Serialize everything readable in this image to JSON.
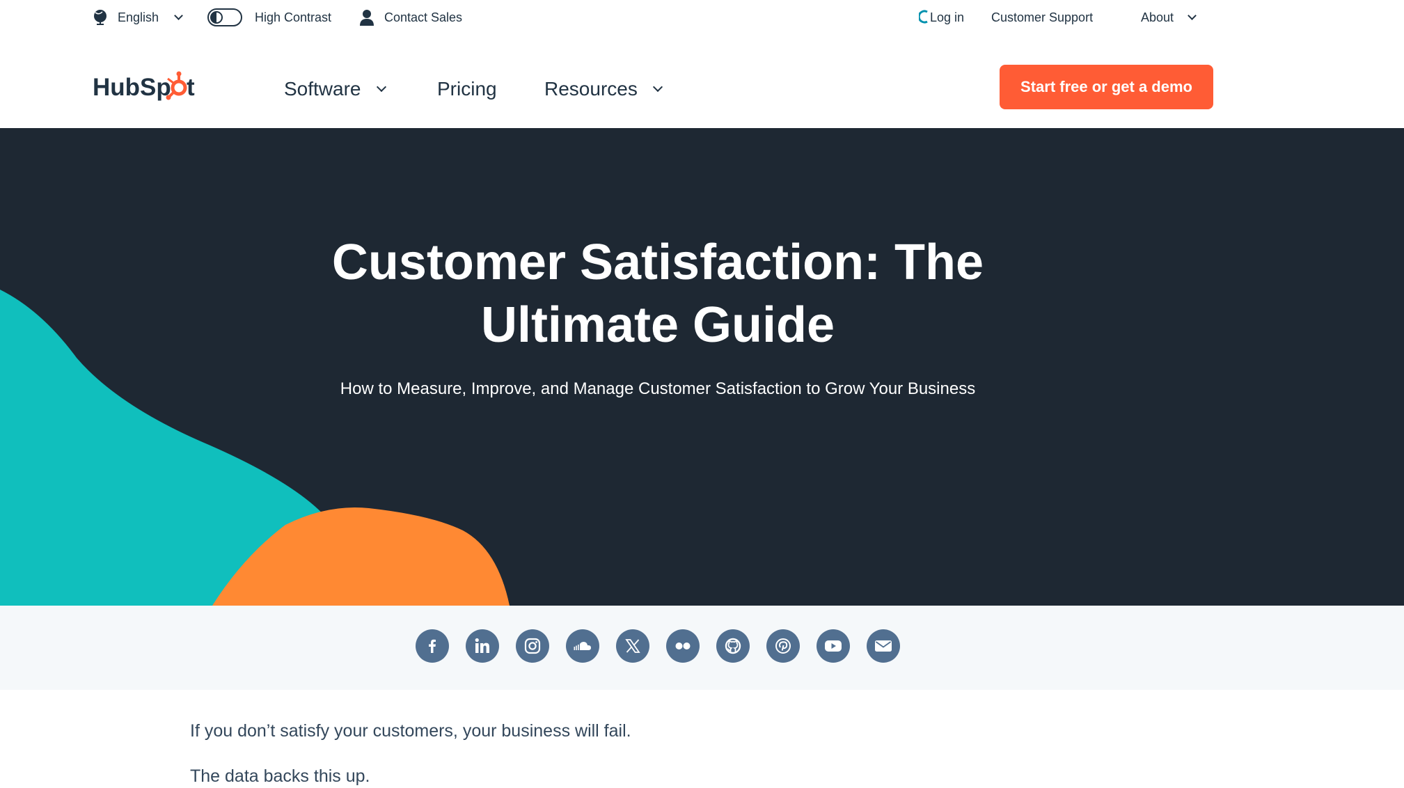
{
  "utility_bar": {
    "language_label": "English",
    "contrast_label": "High Contrast",
    "contact_label": "Contact Sales",
    "login_label": "Log in",
    "support_label": "Customer Support",
    "about_label": "About"
  },
  "nav": {
    "logo_text": "HubSpot",
    "items": [
      {
        "label": "Software"
      },
      {
        "label": "Pricing"
      },
      {
        "label": "Resources"
      }
    ],
    "cta_label": "Start free or get a demo"
  },
  "hero": {
    "title_line1": "Customer Satisfaction: The",
    "title_line2": "Ultimate Guide",
    "subtitle": "How to Measure, Improve, and Manage Customer Satisfaction to Grow Your Business"
  },
  "social_icons": [
    "facebook-icon",
    "linkedin-icon",
    "instagram-icon",
    "soundcloud-icon",
    "x-icon",
    "flickr-icon",
    "github-icon",
    "pinterest-icon",
    "youtube-icon",
    "email-icon"
  ],
  "article": {
    "paragraphs": [
      "If you don’t satisfy your customers, your business will fail.",
      "The data backs this up."
    ]
  },
  "colors": {
    "brand_orange": "#ff5c35",
    "hero_bg": "#1e2833",
    "teal_blob": "#10bfbd",
    "orange_blob": "#ff8933",
    "social_icon_bg": "#516f90"
  }
}
